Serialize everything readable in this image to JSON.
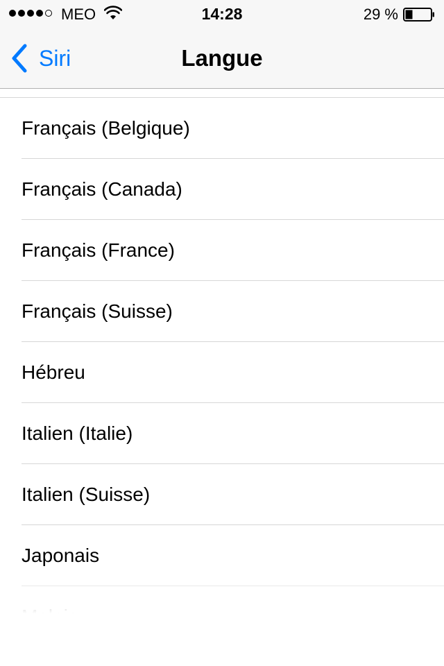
{
  "status_bar": {
    "carrier": "MEO",
    "time": "14:28",
    "battery_percent": "29 %",
    "battery_level": 0.29,
    "signal_strength": 4,
    "signal_max": 5
  },
  "nav": {
    "back_label": "Siri",
    "title": "Langue"
  },
  "list": {
    "items": [
      {
        "label": "Français (Belgique)"
      },
      {
        "label": "Français (Canada)"
      },
      {
        "label": "Français (France)"
      },
      {
        "label": "Français (Suisse)"
      },
      {
        "label": "Hébreu"
      },
      {
        "label": "Italien (Italie)"
      },
      {
        "label": "Italien (Suisse)"
      },
      {
        "label": "Japonais"
      },
      {
        "label": "Malais"
      }
    ]
  },
  "colors": {
    "accent": "#007aff",
    "separator": "#d6d6d6",
    "nav_background": "#f7f7f7"
  },
  "icons": {
    "back": "chevron-left-icon",
    "wifi": "wifi-icon",
    "battery": "battery-icon",
    "signal": "signal-dots-icon"
  }
}
